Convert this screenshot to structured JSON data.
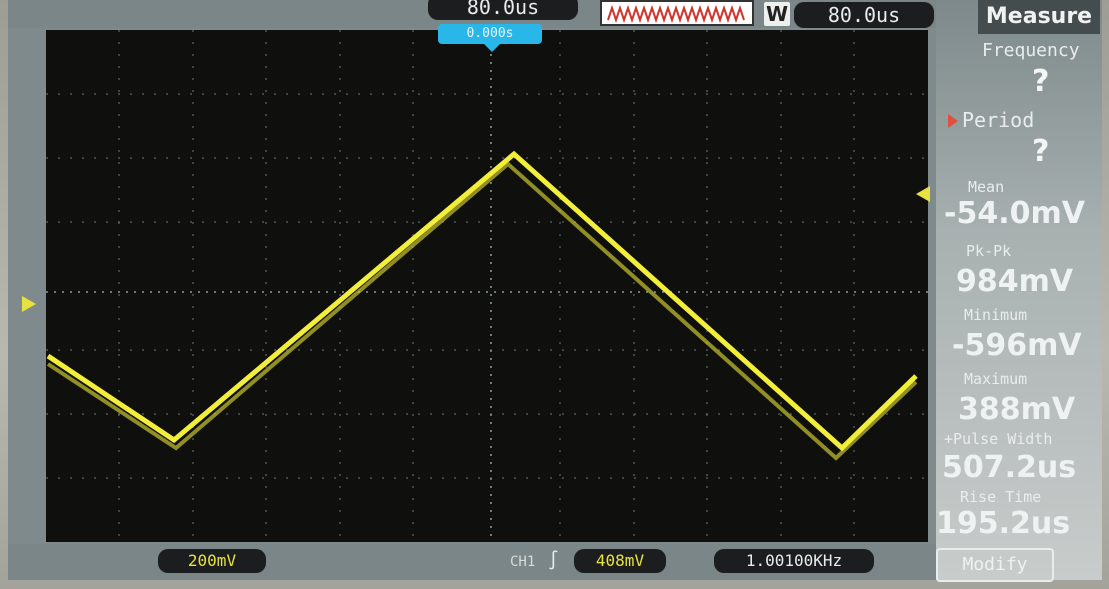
{
  "header": {
    "timebase": "80.0us",
    "window_label": "W",
    "window_time": "80.0us",
    "trigger_position": "0.000s"
  },
  "footer": {
    "ch1_scale": "200mV",
    "trigger_channel": "CH1",
    "trigger_edge_icon": "rising-edge-icon",
    "trigger_level": "408mV",
    "frequency_counter": "1.00100KHz"
  },
  "measure_panel": {
    "title": "Measure",
    "items": [
      {
        "label": "Frequency",
        "value": "?"
      },
      {
        "label": "Period",
        "value": "?"
      },
      {
        "label": "Mean",
        "value": "-54.0mV"
      },
      {
        "label": "Pk-Pk",
        "value": "984mV"
      },
      {
        "label": "Minimum",
        "value": "-596mV"
      },
      {
        "label": "Maximum",
        "value": "388mV"
      },
      {
        "label": "+Pulse Width",
        "value": "507.2us"
      },
      {
        "label": "Rise Time",
        "value": "195.2us"
      }
    ],
    "modify_button": "Modify"
  },
  "colors": {
    "trace": "#f2ee3a",
    "grid": "#6a7a7c",
    "trigger_marker": "#29b7ea",
    "selection_arrow": "#e0503c"
  },
  "waveform": {
    "type": "triangle",
    "channel": "CH1"
  }
}
